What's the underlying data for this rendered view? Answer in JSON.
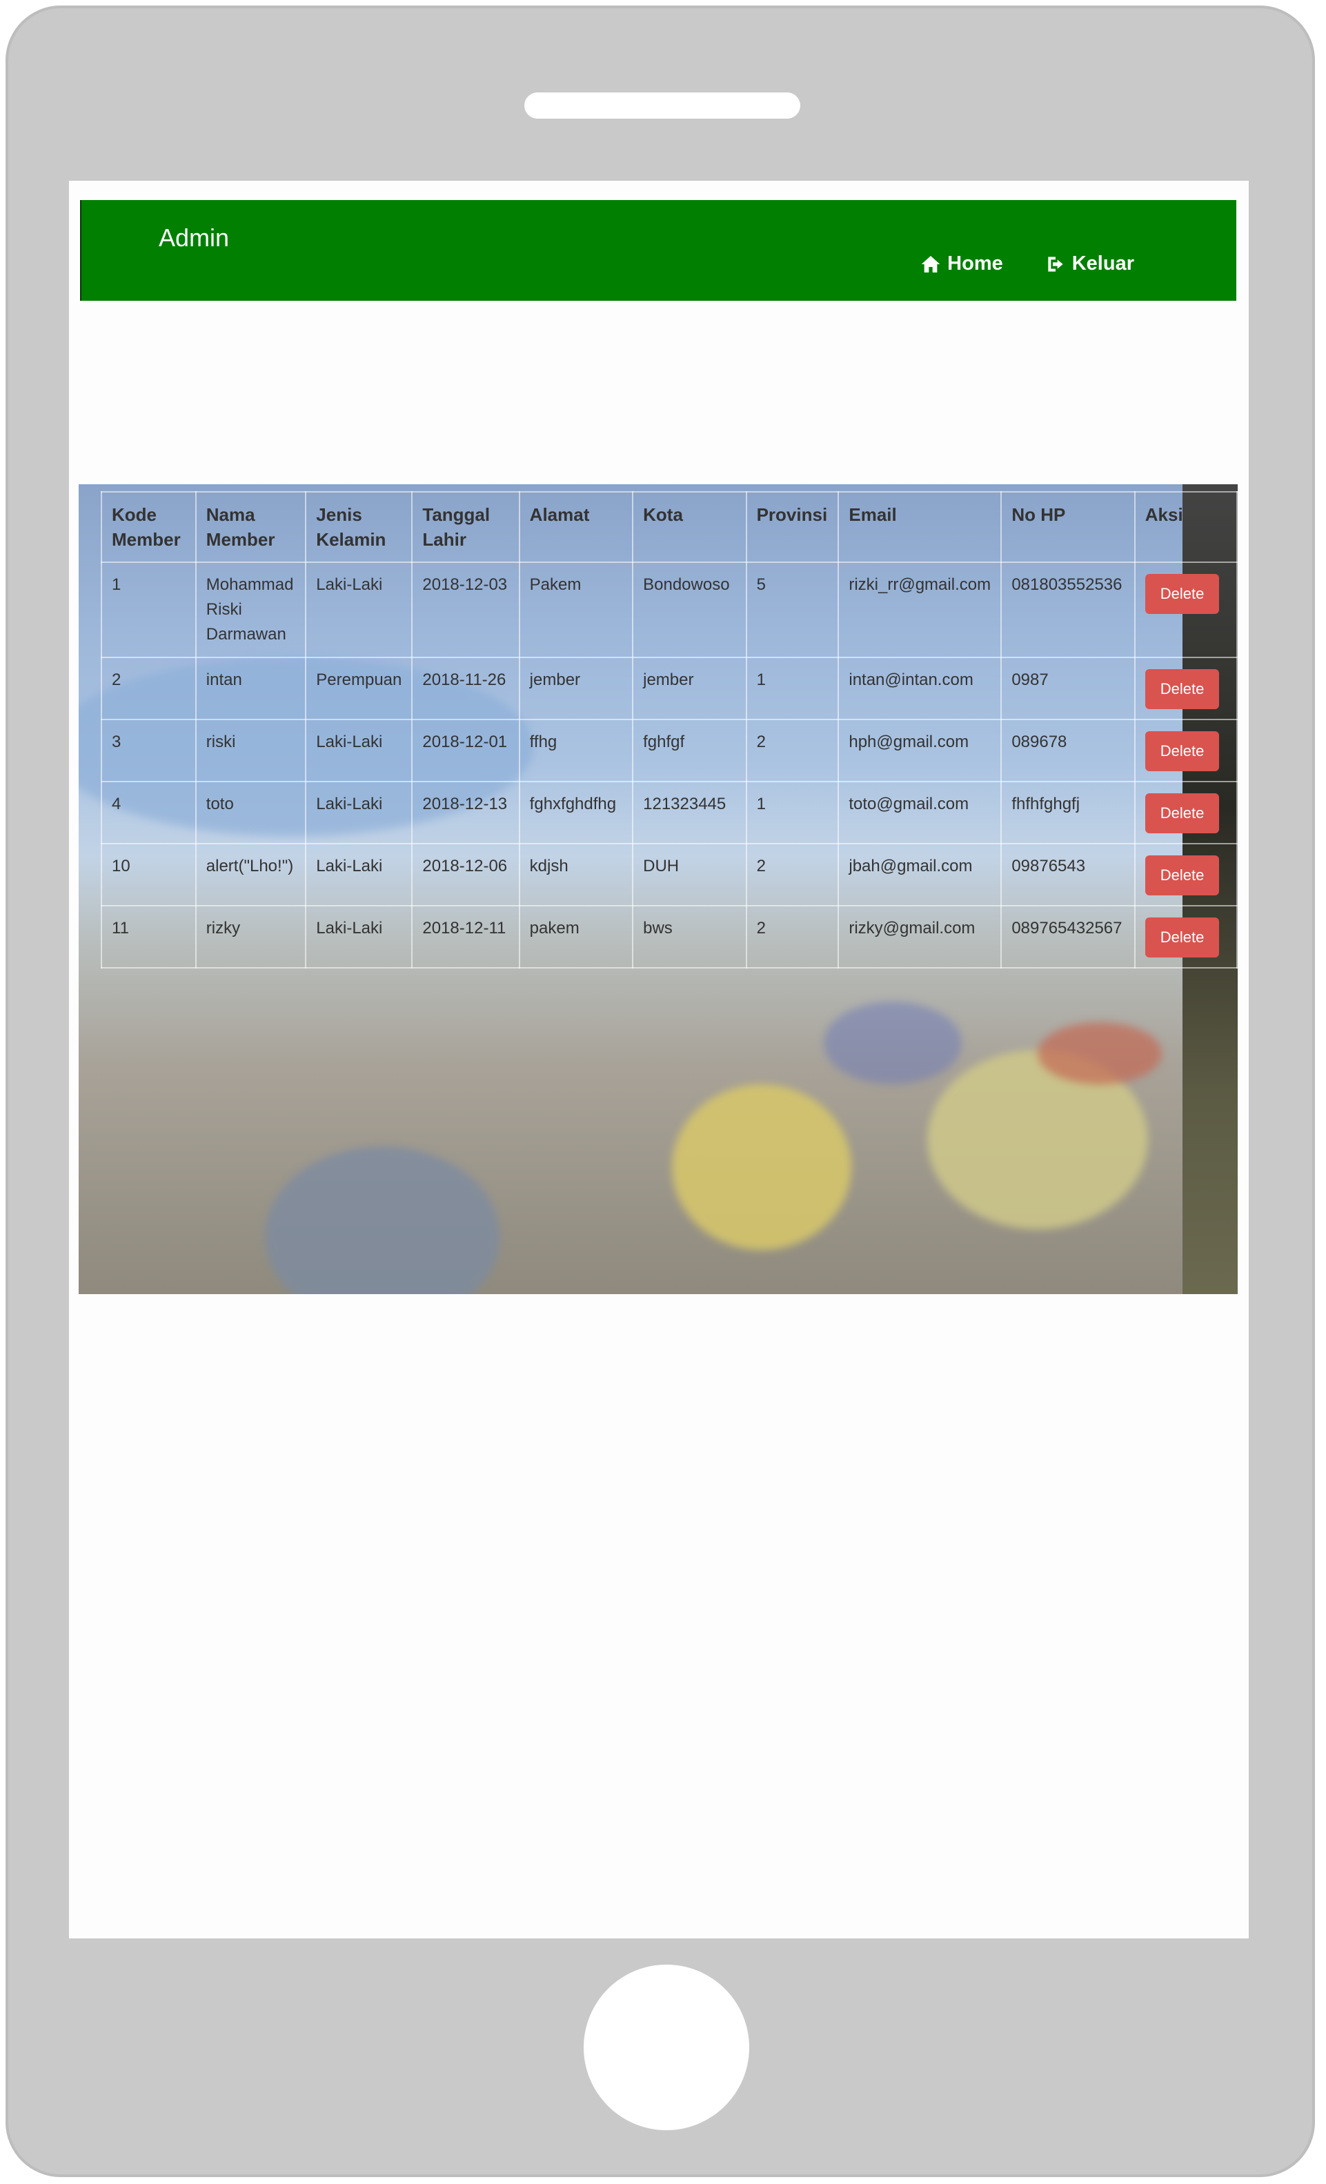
{
  "navbar": {
    "brand": "Admin",
    "links": [
      {
        "icon": "home-icon",
        "label": "Home"
      },
      {
        "icon": "sign-out-icon",
        "label": "Keluar"
      }
    ],
    "color": "#007f00"
  },
  "table": {
    "headers": [
      "Kode Member",
      "Nama Member",
      "Jenis Kelamin",
      "Tanggal Lahir",
      "Alamat",
      "Kota",
      "Provinsi",
      "Email",
      "No HP",
      "Aksi"
    ],
    "rows": [
      {
        "kode": "1",
        "nama": "Mohammad Riski Darmawan",
        "jk": "Laki-Laki",
        "tgl": "2018-12-03",
        "alamat": "Pakem",
        "kota": "Bondowoso",
        "prov": "5",
        "email": "rizki_rr@gmail.com",
        "hp": "081803552536",
        "aksi": "Delete"
      },
      {
        "kode": "2",
        "nama": "intan",
        "jk": "Perempuan",
        "tgl": "2018-11-26",
        "alamat": "jember",
        "kota": "jember",
        "prov": "1",
        "email": "intan@intan.com",
        "hp": "0987",
        "aksi": "Delete"
      },
      {
        "kode": "3",
        "nama": "riski",
        "jk": "Laki-Laki",
        "tgl": "2018-12-01",
        "alamat": "ffhg",
        "kota": "fghfgf",
        "prov": "2",
        "email": "hph@gmail.com",
        "hp": "089678",
        "aksi": "Delete"
      },
      {
        "kode": "4",
        "nama": "toto",
        "jk": "Laki-Laki",
        "tgl": "2018-12-13",
        "alamat": "fghxfghdfhg",
        "kota": "121323445",
        "prov": "1",
        "email": "toto@gmail.com",
        "hp": "fhfhfghgfj",
        "aksi": "Delete"
      },
      {
        "kode": "10",
        "nama": "alert(\"Lho!\")",
        "jk": "Laki-Laki",
        "tgl": "2018-12-06",
        "alamat": "kdjsh",
        "kota": "DUH",
        "prov": "2",
        "email": "jbah@gmail.com",
        "hp": "09876543",
        "aksi": "Delete"
      },
      {
        "kode": "11",
        "nama": "rizky",
        "jk": "Laki-Laki",
        "tgl": "2018-12-11",
        "alamat": "pakem",
        "kota": "bws",
        "prov": "2",
        "email": "rizky@gmail.com",
        "hp": "089765432567",
        "aksi": "Delete"
      }
    ],
    "delete_color": "#d9534f"
  }
}
